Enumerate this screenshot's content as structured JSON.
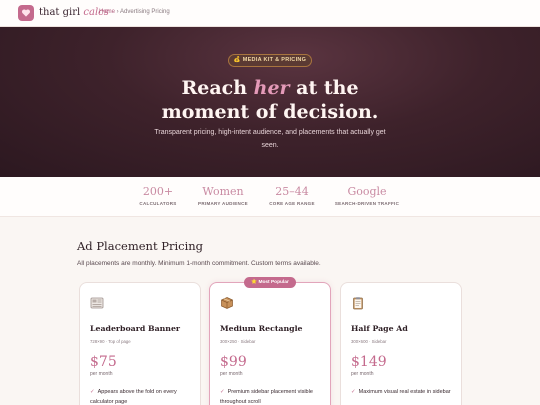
{
  "brand": {
    "name_plain": "that girl",
    "name_accent": "calcs"
  },
  "breadcrumb": {
    "home": "Home",
    "separator": " › ",
    "current": "Advertising Pricing"
  },
  "hero": {
    "badge": "💰 MEDIA KIT & PRICING",
    "title_line1_before": "Reach ",
    "title_line1_accent": "her",
    "title_line1_after": " at the",
    "title_line2": "moment of decision.",
    "subtitle": "Transparent pricing, high-intent audience, and placements that actually get seen."
  },
  "stats": [
    {
      "value": "200+",
      "label": "CALCULATORS"
    },
    {
      "value": "Women",
      "label": "PRIMARY AUDIENCE"
    },
    {
      "value": "25–44",
      "label": "CORE AGE RANGE"
    },
    {
      "value": "Google",
      "label": "SEARCH-DRIVEN TRAFFIC"
    }
  ],
  "pricing": {
    "title": "Ad Placement Pricing",
    "subtitle": "All placements are monthly. Minimum 1-month commitment. Custom terms available.",
    "popular_badge": "⭐ Most Popular",
    "check_glyph": "✓",
    "cards": [
      {
        "icon": "newspaper-icon",
        "title": "Leaderboard Banner",
        "spec": "728×90 · Top of page",
        "price": "$75",
        "period": "per month",
        "feature": "Appears above the fold on every calculator page"
      },
      {
        "icon": "package-icon",
        "title": "Medium Rectangle",
        "spec": "300×250 · Sidebar",
        "price": "$99",
        "period": "per month",
        "feature": "Premium sidebar placement visible throughout scroll"
      },
      {
        "icon": "clipboard-icon",
        "title": "Half Page Ad",
        "spec": "300×600 · Sidebar",
        "price": "$149",
        "period": "per month",
        "feature": "Maximum visual real estate in sidebar"
      }
    ]
  },
  "colors": {
    "accent": "#c46a8d",
    "hero_bg": "#3e222b",
    "badge_gold": "#a8743f"
  }
}
